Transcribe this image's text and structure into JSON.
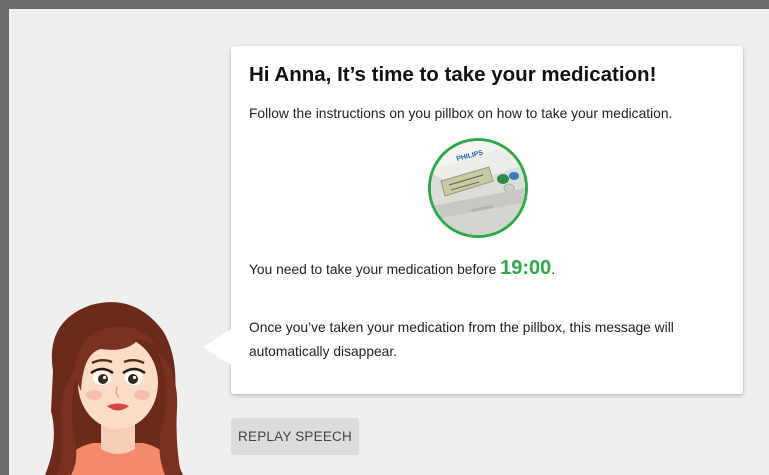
{
  "message": {
    "title": "Hi Anna, It’s time to take your medication!",
    "instructions": "Follow the instructions on you pillbox on how to take your medication.",
    "deadline_prefix": "You need to take your medication before ",
    "deadline_time": "19:00",
    "deadline_suffix": ".",
    "disappear_text": " Once you’ve taken your medication from the pillbox, this message will automatically disappear."
  },
  "pillbox": {
    "brand": "PHILIPS",
    "icon": "pillbox-device-image"
  },
  "actions": {
    "replay_label": "REPLAY SPEECH"
  },
  "avatar": {
    "icon": "assistant-avatar"
  },
  "colors": {
    "accent": "#2ea84a",
    "frame_border": "#6b6b6b",
    "background": "#efefef",
    "card": "#ffffff",
    "button": "#dcdcdc"
  }
}
